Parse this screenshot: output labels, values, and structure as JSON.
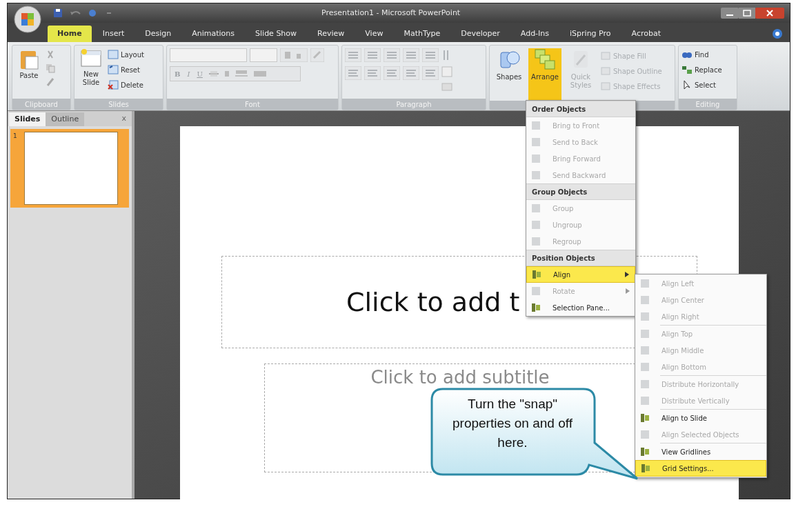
{
  "window": {
    "title": "Presentation1 - Microsoft PowerPoint"
  },
  "tabs": [
    {
      "label": "Home",
      "selected": true
    },
    {
      "label": "Insert",
      "selected": false
    },
    {
      "label": "Design",
      "selected": false
    },
    {
      "label": "Animations",
      "selected": false
    },
    {
      "label": "Slide Show",
      "selected": false
    },
    {
      "label": "Review",
      "selected": false
    },
    {
      "label": "View",
      "selected": false
    },
    {
      "label": "MathType",
      "selected": false
    },
    {
      "label": "Developer",
      "selected": false
    },
    {
      "label": "Add-Ins",
      "selected": false
    },
    {
      "label": "iSpring Pro",
      "selected": false
    },
    {
      "label": "Acrobat",
      "selected": false
    }
  ],
  "ribbon": {
    "clipboard": {
      "label": "Clipboard",
      "paste": "Paste"
    },
    "slides": {
      "label": "Slides",
      "new_slide": "New Slide",
      "items": [
        "Layout",
        "Reset",
        "Delete"
      ]
    },
    "font": {
      "label": "Font",
      "format_buttons": [
        "B",
        "I",
        "U"
      ]
    },
    "paragraph": {
      "label": "Paragraph"
    },
    "drawing": {
      "buttons": [
        {
          "label": "Shapes",
          "selected": false,
          "disabled": false
        },
        {
          "label": "Arrange",
          "selected": true,
          "disabled": false
        },
        {
          "label": "Quick Styles",
          "selected": false,
          "disabled": true
        }
      ],
      "items": [
        {
          "label": "Shape Fill",
          "disabled": true
        },
        {
          "label": "Shape Outline",
          "disabled": true
        },
        {
          "label": "Shape Effects",
          "disabled": true
        }
      ]
    },
    "editing": {
      "label": "Editing",
      "items": [
        "Find",
        "Replace",
        "Select"
      ]
    }
  },
  "slide_pane": {
    "tabs": [
      {
        "label": "Slides",
        "selected": true
      },
      {
        "label": "Outline",
        "selected": false
      }
    ],
    "close": "x",
    "thumbnails": [
      {
        "number": "1",
        "selected": true
      }
    ]
  },
  "slide": {
    "title_placeholder": "Click to add t",
    "subtitle_placeholder": "Click to add subtitle"
  },
  "arrange_menu": [
    {
      "header": "Order Objects",
      "items": [
        {
          "label": "Bring to Front",
          "disabled": true,
          "selected": false,
          "submenu": false
        },
        {
          "label": "Send to Back",
          "disabled": true,
          "selected": false,
          "submenu": false
        },
        {
          "label": "Bring Forward",
          "disabled": true,
          "selected": false,
          "submenu": false
        },
        {
          "label": "Send Backward",
          "disabled": true,
          "selected": false,
          "submenu": false
        }
      ]
    },
    {
      "header": "Group Objects",
      "items": [
        {
          "label": "Group",
          "disabled": true,
          "selected": false,
          "submenu": false
        },
        {
          "label": "Ungroup",
          "disabled": true,
          "selected": false,
          "submenu": false
        },
        {
          "label": "Regroup",
          "disabled": true,
          "selected": false,
          "submenu": false
        }
      ]
    },
    {
      "header": "Position Objects",
      "items": [
        {
          "label": "Align",
          "disabled": false,
          "selected": true,
          "submenu": true
        },
        {
          "label": "Rotate",
          "disabled": true,
          "selected": false,
          "submenu": true
        },
        {
          "label": "Selection Pane...",
          "disabled": false,
          "selected": false,
          "submenu": false
        }
      ]
    }
  ],
  "align_submenu": [
    [
      {
        "label": "Align Left",
        "disabled": true,
        "selected": false
      },
      {
        "label": "Align Center",
        "disabled": true,
        "selected": false
      },
      {
        "label": "Align Right",
        "disabled": true,
        "selected": false
      }
    ],
    [
      {
        "label": "Align Top",
        "disabled": true,
        "selected": false
      },
      {
        "label": "Align Middle",
        "disabled": true,
        "selected": false
      },
      {
        "label": "Align Bottom",
        "disabled": true,
        "selected": false
      }
    ],
    [
      {
        "label": "Distribute Horizontally",
        "disabled": true,
        "selected": false
      },
      {
        "label": "Distribute Vertically",
        "disabled": true,
        "selected": false
      }
    ],
    [
      {
        "label": "Align to Slide",
        "disabled": false,
        "selected": false
      },
      {
        "label": "Align Selected Objects",
        "disabled": true,
        "selected": false
      }
    ],
    [
      {
        "label": "View Gridlines",
        "disabled": false,
        "selected": false
      },
      {
        "label": "Grid Settings...",
        "disabled": false,
        "selected": true
      }
    ]
  ],
  "callout": {
    "text": "Turn the \"snap\" properties on and off here."
  }
}
